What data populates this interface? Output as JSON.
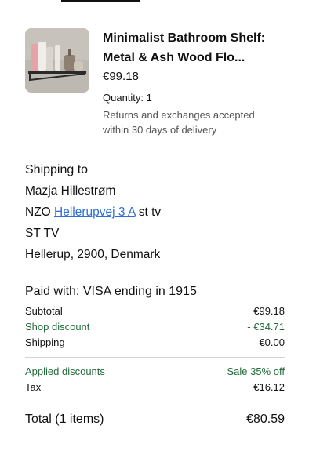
{
  "item": {
    "title_line1": "Minimalist Bathroom Shelf:",
    "title_line2": "Metal & Ash Wood Flo...",
    "price": "€99.18",
    "quantity": "Quantity: 1",
    "returns_line1": "Returns and exchanges accepted",
    "returns_line2": "within 30 days of delivery"
  },
  "shipping": {
    "title": "Shipping to",
    "name": "Mazja Hillestrøm",
    "addr_prefix": "NZO",
    "addr_link": "Hellerupvej 3 A",
    "addr_suffix": "st tv",
    "line3": "ST TV",
    "line4": "Hellerup, 2900, Denmark"
  },
  "payment": {
    "paid_label": "Paid with:",
    "paid_value": "VISA ending in 1915",
    "subtotal_label": "Subtotal",
    "subtotal_value": "€99.18",
    "shop_discount_label": "Shop discount",
    "shop_discount_value": "- €34.71",
    "shipping_label": "Shipping",
    "shipping_value": "€0.00",
    "applied_discounts_label": "Applied discounts",
    "applied_discounts_value": "Sale 35% off",
    "tax_label": "Tax",
    "tax_value": "€16.12",
    "total_label": "Total (1 items)",
    "total_value": "€80.59"
  },
  "colors": {
    "link": "#2f6fd6",
    "discount_green": "#236b3a"
  }
}
